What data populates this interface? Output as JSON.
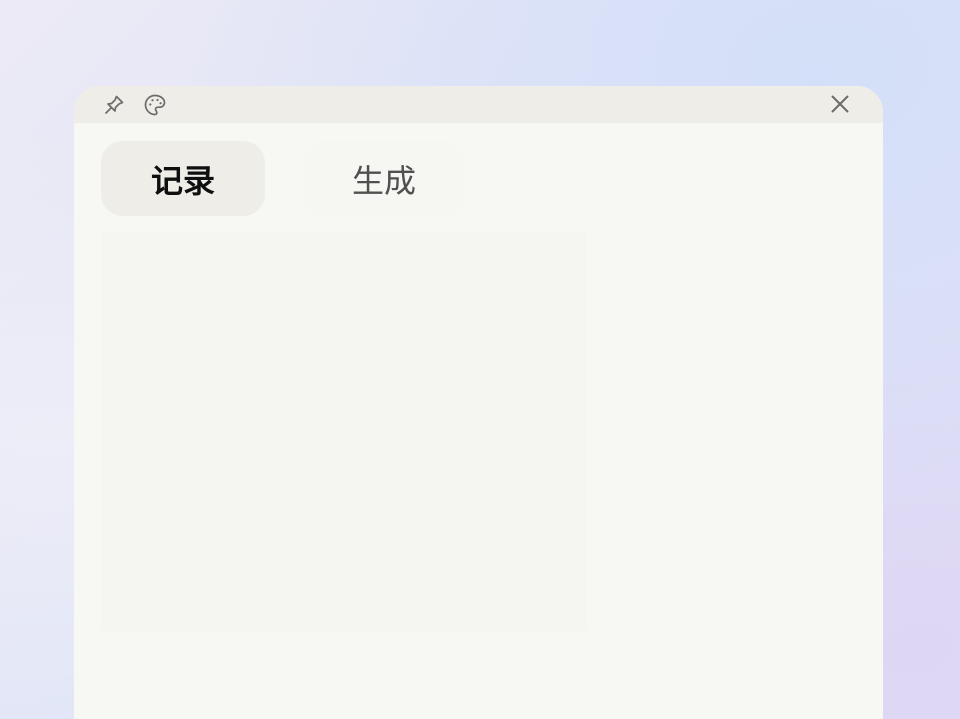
{
  "window": {
    "titlebar": {
      "pin_icon": "pin-icon",
      "palette_icon": "palette-icon",
      "close_icon": "close-icon"
    },
    "tabs": [
      {
        "label": "记录",
        "active": true
      },
      {
        "label": "生成",
        "active": false
      }
    ]
  },
  "colors": {
    "titlebar_bg": "#efede7",
    "window_bg": "#f7f7f3",
    "active_tab_bg": "#eeede7",
    "active_tab_text": "#0f0f0f",
    "inactive_tab_text": "#505050",
    "icon_color": "#6b6b6b"
  }
}
